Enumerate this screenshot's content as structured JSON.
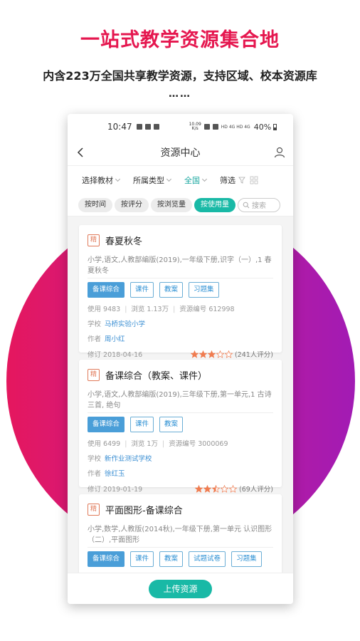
{
  "promo": {
    "headline": "一站式教学资源集合地",
    "subline": "内含223万全国共享教学资源，支持区域、校本资源库",
    "dots": "……"
  },
  "colors": {
    "accent": "#19b9a6",
    "headline": "#e5174f",
    "link": "#3b8fd3"
  },
  "statusbar": {
    "time": "10:47",
    "speed_top": "10.09",
    "speed_bottom": "K/s",
    "network_text": "HD 4G HD 4G",
    "battery": "40%"
  },
  "navbar": {
    "title": "资源中心",
    "back_icon": "chevron-left-icon",
    "user_icon": "user-icon"
  },
  "filters": [
    {
      "label": "选择教材"
    },
    {
      "label": "所属类型"
    },
    {
      "label": "全国"
    },
    {
      "label": "筛选"
    }
  ],
  "sort": {
    "chips": [
      "按时间",
      "按评分",
      "按浏览量",
      "按使用量"
    ],
    "active": "按使用量",
    "search_placeholder": "搜索"
  },
  "cards": [
    {
      "tag": "精",
      "title": "春夏秋冬",
      "desc": "小学,语文,人教部编版(2019),一年级下册,识字（一）,1 春夏秋冬",
      "buttons": [
        "备课综合",
        "课件",
        "教案",
        "习题集"
      ],
      "use": "使用 9483",
      "views": "浏览 1.13万",
      "code": "资源编号 612998",
      "school_label": "学校",
      "school": "马桥实验小学",
      "author_label": "作者",
      "author": "周小红",
      "revised": "修订 2018-04-16",
      "rating": 3,
      "rating_text": "(241人评分)"
    },
    {
      "tag": "精",
      "title": "备课综合（教案、课件）",
      "desc": "小学,语文,人教部编版(2019),三年级下册,第一单元,1 古诗三首, 绝句",
      "buttons": [
        "备课综合",
        "课件",
        "教案"
      ],
      "use": "使用 6499",
      "views": "浏览 1万",
      "code": "资源编号 3000069",
      "school_label": "学校",
      "school": "新作业测试学校",
      "author_label": "作者",
      "author": "徐红玉",
      "revised": "修订 2019-01-19",
      "rating": 2.5,
      "rating_text": "(69人评分)"
    },
    {
      "tag": "精",
      "title": "平面图形-备课综合",
      "desc": "小学,数学,人教版(2014秋),一年级下册,第一单元 认识图形（二）,平面图形",
      "buttons": [
        "备课综合",
        "课件",
        "教案",
        "试题试卷",
        "习题集"
      ]
    }
  ],
  "upload_label": "上传资源"
}
